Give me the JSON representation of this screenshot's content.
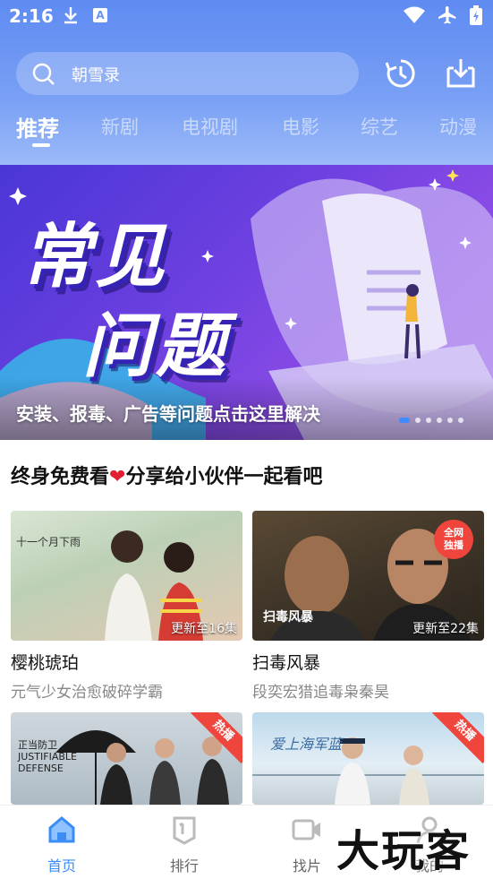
{
  "status_bar": {
    "time": "2:16",
    "download_icon": "download-icon",
    "a_icon_text": "A"
  },
  "search": {
    "placeholder": "朝雪录"
  },
  "tabs": [
    {
      "label": "推荐",
      "active": true
    },
    {
      "label": "新剧"
    },
    {
      "label": "电视剧"
    },
    {
      "label": "电影"
    },
    {
      "label": "综艺"
    },
    {
      "label": "动漫"
    }
  ],
  "banner": {
    "title_line1": "常见",
    "title_line2": "问题",
    "caption": "安装、报毒、广告等问题点击这里解决",
    "active_slide": 1,
    "slide_count": 6
  },
  "section": {
    "title_before": "终身免费看",
    "heart": "❤",
    "title_after": "分享给小伙伴一起看吧"
  },
  "cards": [
    {
      "title": "樱桃琥珀",
      "subtitle": "元气少女治愈破碎学霸",
      "update": "更新至16集",
      "poster_text": "十一个月下雨"
    },
    {
      "title": "扫毒风暴",
      "subtitle": "段奕宏猎追毒枭秦昊",
      "update": "更新至22集",
      "badge": "全网独播",
      "poster_text": "扫毒风暴"
    },
    {
      "hot": "热播",
      "poster_text": "正当防卫 JUSTIFIABLE DEFENSE"
    },
    {
      "hot": "热播",
      "poster_text": "爱上海军蓝"
    }
  ],
  "bottom_nav": [
    {
      "label": "首页",
      "icon": "home-icon",
      "active": true
    },
    {
      "label": "排行",
      "icon": "ranking-icon"
    },
    {
      "label": "找片",
      "icon": "video-icon"
    },
    {
      "label": "我的",
      "icon": "user-icon"
    }
  ],
  "watermark": "大玩客",
  "colors": {
    "accent": "#3b8cf7",
    "header": "#6b93f3",
    "hot": "#f0453d"
  }
}
